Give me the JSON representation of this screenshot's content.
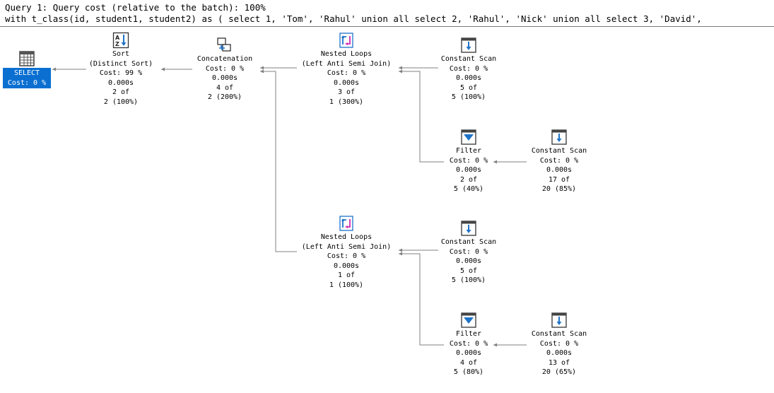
{
  "header": {
    "line1": "Query 1: Query cost (relative to the batch): 100%",
    "line2": "with t_class(id, student1, student2) as ( select 1, 'Tom', 'Rahul' union all select 2, 'Rahul', 'Nick' union all select 3, 'David', "
  },
  "plan": {
    "select": {
      "label": "SELECT",
      "cost": "Cost: 0 %"
    },
    "sort": {
      "name": "Sort",
      "sub": "(Distinct Sort)",
      "cost": "Cost: 99 %",
      "time": "0.000s",
      "rows": "2 of",
      "est": "2 (100%)"
    },
    "concat": {
      "name": "Concatenation",
      "cost": "Cost: 0 %",
      "time": "0.000s",
      "rows": "4 of",
      "est": "2 (200%)"
    },
    "nl1": {
      "name": "Nested Loops",
      "sub": "(Left Anti Semi Join)",
      "cost": "Cost: 0 %",
      "time": "0.000s",
      "rows": "3 of",
      "est": "1 (300%)"
    },
    "cs1": {
      "name": "Constant Scan",
      "cost": "Cost: 0 %",
      "time": "0.000s",
      "rows": "5 of",
      "est": "5 (100%)"
    },
    "filter1": {
      "name": "Filter",
      "cost": "Cost: 0 %",
      "time": "0.000s",
      "rows": "2 of",
      "est": "5 (40%)"
    },
    "cs2": {
      "name": "Constant Scan",
      "cost": "Cost: 0 %",
      "time": "0.000s",
      "rows": "17 of",
      "est": "20 (85%)"
    },
    "nl2": {
      "name": "Nested Loops",
      "sub": "(Left Anti Semi Join)",
      "cost": "Cost: 0 %",
      "time": "0.000s",
      "rows": "1 of",
      "est": "1 (100%)"
    },
    "cs3": {
      "name": "Constant Scan",
      "cost": "Cost: 0 %",
      "time": "0.000s",
      "rows": "5 of",
      "est": "5 (100%)"
    },
    "filter2": {
      "name": "Filter",
      "cost": "Cost: 0 %",
      "time": "0.000s",
      "rows": "4 of",
      "est": "5 (80%)"
    },
    "cs4": {
      "name": "Constant Scan",
      "cost": "Cost: 0 %",
      "time": "0.000s",
      "rows": "13 of",
      "est": "20 (65%)"
    }
  },
  "icons": {
    "select": "table-grid-icon",
    "sort": "sort-az-icon",
    "concat": "concatenation-icon",
    "nested_loops": "nested-loops-icon",
    "constant_scan": "constant-scan-icon",
    "filter": "filter-icon"
  },
  "colors": {
    "select_highlight": "#0a6fd1",
    "icon_blue": "#1e73c8",
    "icon_magenta": "#d02ab0"
  }
}
